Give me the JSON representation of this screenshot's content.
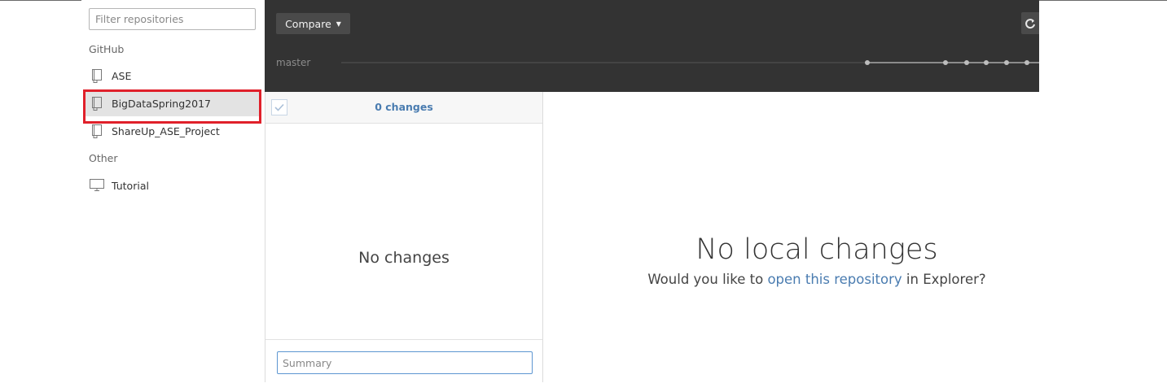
{
  "sidebar": {
    "filter_placeholder": "Filter repositories",
    "sections": [
      {
        "label": "GitHub",
        "repos": [
          {
            "name": "ASE",
            "icon": "repo-icon"
          },
          {
            "name": "BigDataSpring2017",
            "icon": "repo-icon",
            "selected": true
          },
          {
            "name": "ShareUp_ASE_Project",
            "icon": "repo-icon"
          }
        ]
      },
      {
        "label": "Other",
        "repos": [
          {
            "name": "Tutorial",
            "icon": "computer-icon"
          }
        ]
      }
    ]
  },
  "header": {
    "compare_label": "Compare",
    "branch": "master"
  },
  "changes": {
    "count_label": "0 changes",
    "empty_label": "No changes",
    "summary_placeholder": "Summary"
  },
  "main": {
    "title": "No local changes",
    "subtitle_prefix": "Would you like to ",
    "subtitle_link": "open this repository",
    "subtitle_suffix": " in Explorer?"
  },
  "colors": {
    "dark_header": "#333333",
    "accent_blue": "#4a7cb0",
    "selection_highlight": "#e0202a"
  }
}
